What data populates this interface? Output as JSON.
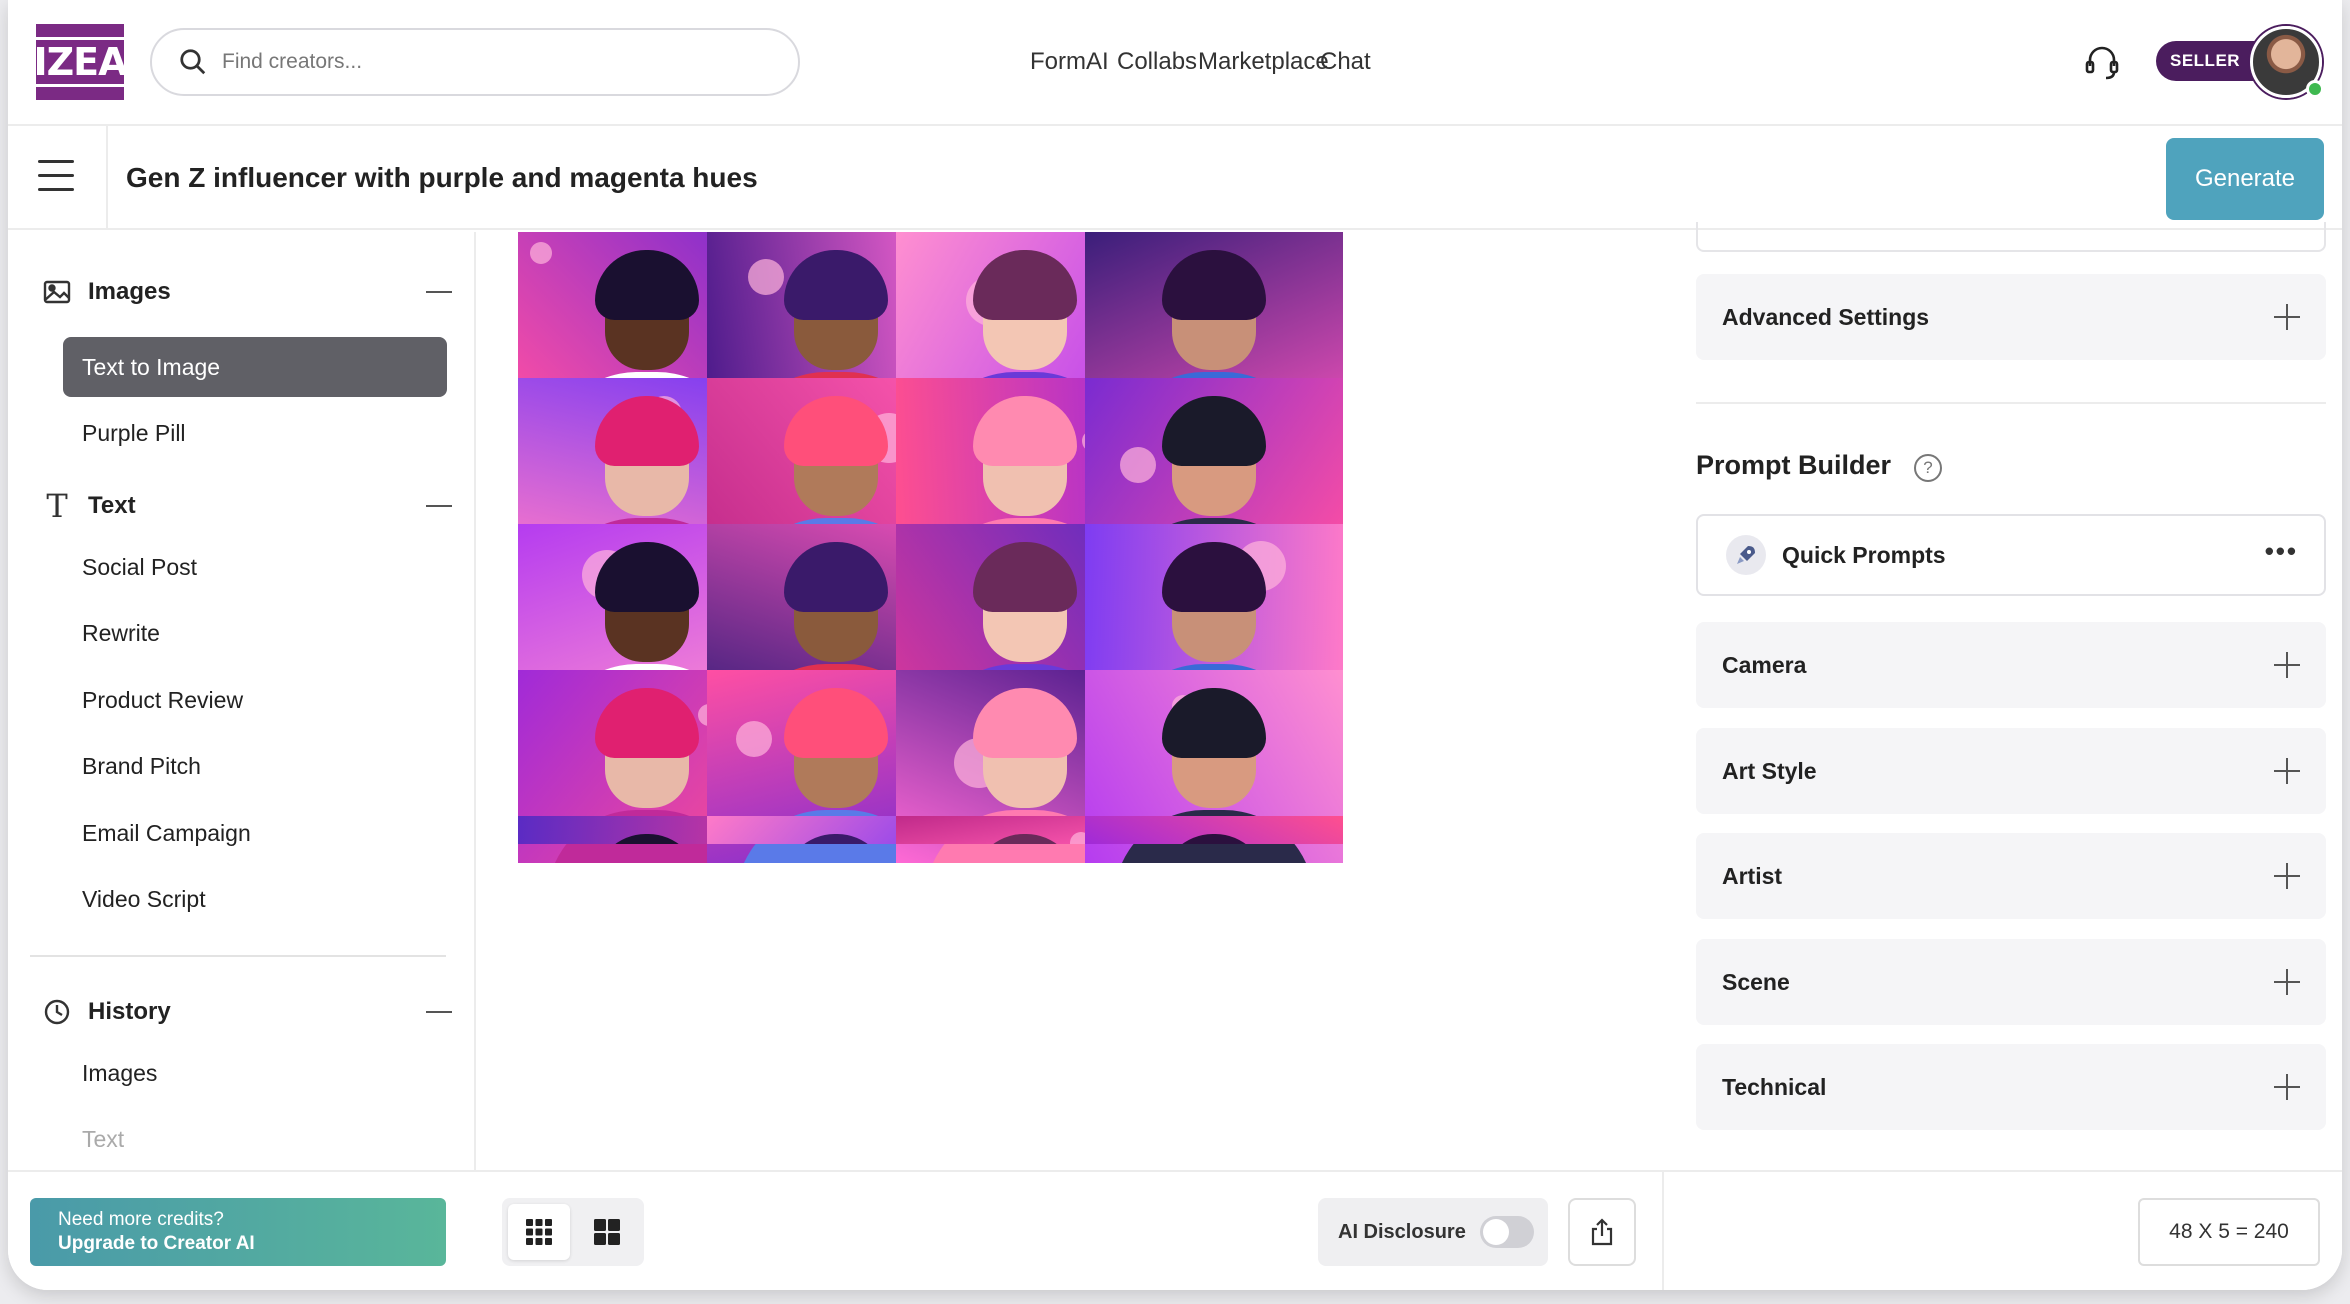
{
  "header": {
    "logo_text": "IZEA",
    "search_placeholder": "Find creators...",
    "nav": [
      "FormAI",
      "Collabs",
      "Marketplace",
      "Chat"
    ],
    "seller_badge": "SELLER"
  },
  "prompt": {
    "value": "Gen Z influencer with purple and magenta hues",
    "generate_label": "Generate"
  },
  "sidebar": {
    "images_title": "Images",
    "images_items": [
      "Text to Image",
      "Purple Pill"
    ],
    "text_title": "Text",
    "text_items": [
      "Social Post",
      "Rewrite",
      "Product Review",
      "Brand Pitch",
      "Email Campaign",
      "Video Script"
    ],
    "history_title": "History",
    "history_items": [
      "Images",
      "Text"
    ]
  },
  "footer": {
    "credits_line1": "Need more credits?",
    "credits_line2": "Upgrade to Creator AI",
    "ai_disclosure_label": "AI Disclosure",
    "ai_disclosure_on": false,
    "count_label": "48 X 5 = 240"
  },
  "right_panel": {
    "advanced_settings": "Advanced Settings",
    "prompt_builder_title": "Prompt Builder",
    "help_glyph": "?",
    "quick_prompts": "Quick Prompts",
    "sections": [
      "Camera",
      "Art Style",
      "Artist",
      "Scene",
      "Technical"
    ]
  },
  "colors": {
    "brand_purple": "#7b2a84",
    "generate_teal": "#4fa3bd",
    "active_item_bg": "#606066"
  },
  "icons": [
    "search-icon",
    "headset-icon",
    "hamburger-icon",
    "image-icon",
    "text-icon",
    "clock-icon",
    "grid-small-icon",
    "grid-large-icon",
    "share-icon",
    "rocket-icon",
    "help-icon"
  ]
}
